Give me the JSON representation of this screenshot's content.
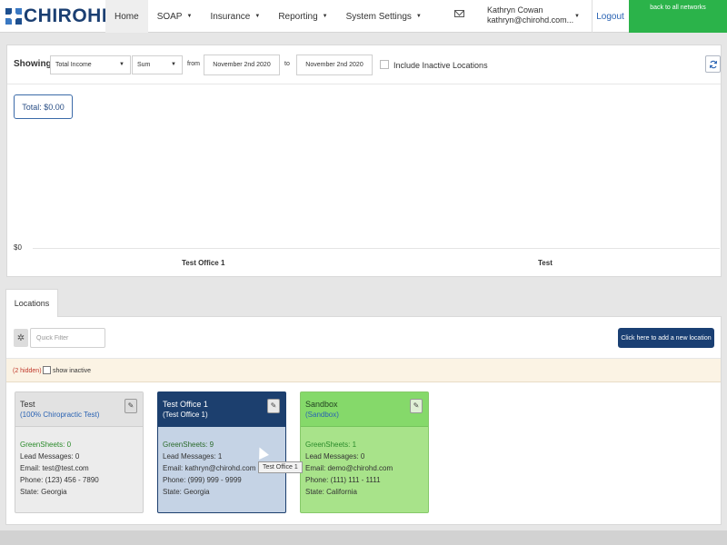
{
  "header": {
    "logo_text": "CHIROHD",
    "nav": [
      {
        "label": "Home",
        "has_menu": false
      },
      {
        "label": "SOAP",
        "has_menu": true
      },
      {
        "label": "Insurance",
        "has_menu": true
      },
      {
        "label": "Reporting",
        "has_menu": true
      },
      {
        "label": "System Settings",
        "has_menu": true
      }
    ],
    "user_name": "Kathryn Cowan",
    "user_email": "kathryn@chirohd.com...",
    "logout_label": "Logout",
    "back_label": "back to all networks",
    "back_color": "#2bb34a"
  },
  "report": {
    "showing_label": "Showing",
    "metric": "Total Income",
    "aggregate": "Sum",
    "from_label": "from",
    "from_date": "November 2nd 2020",
    "to_label": "to",
    "to_date": "November 2nd 2020",
    "include_inactive_label": "Include Inactive Locations",
    "include_inactive_checked": false,
    "total_label": "Total: $0.00",
    "y_tick": "$0",
    "x_ticks": [
      "Test Office 1",
      "Test"
    ]
  },
  "locations": {
    "tab_label": "Locations",
    "quick_filter_placeholder": "Quick Filter",
    "add_button_label": "Click here to add a new location",
    "hidden_count": "(2 hidden)",
    "show_inactive_label": "show inactive",
    "cards": [
      {
        "title": "Test",
        "subtitle": "(100% Chiropractic Test)",
        "greensheets": "GreenSheets: 0",
        "lead_messages": "Lead Messages: 0",
        "email": "Email: test@test.com",
        "phone": "Phone: (123) 456 - 7890",
        "state": "State: Georgia"
      },
      {
        "title": "Test Office 1",
        "subtitle": "(Test Office 1)",
        "greensheets": "GreenSheets: 9",
        "lead_messages": "Lead Messages: 1",
        "email": "Email: kathryn@chirohd.com",
        "phone": "Phone: (999) 999 - 9999",
        "state": "State: Georgia"
      },
      {
        "title": "Sandbox",
        "subtitle": "(Sandbox)",
        "greensheets": "GreenSheets: 1",
        "lead_messages": "Lead Messages: 0",
        "email": "Email: demo@chirohd.com",
        "phone": "Phone: (111) 111 - 1111",
        "state": "State: California"
      }
    ],
    "tooltip": "Test Office 1"
  },
  "colors": {
    "brand_navy": "#1c3f6e",
    "brand_green": "#2bb34a",
    "link_blue": "#2a63b3"
  }
}
